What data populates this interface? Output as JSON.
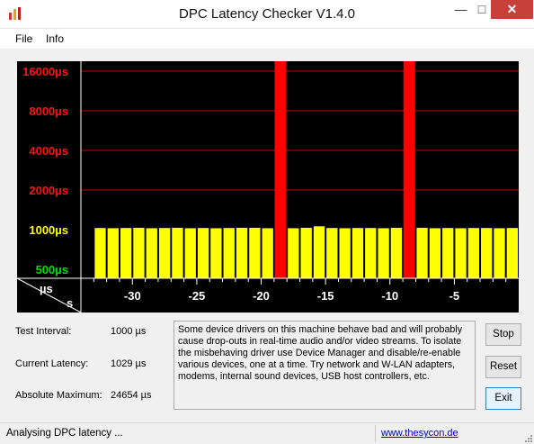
{
  "window": {
    "title": "DPC Latency Checker V1.4.0",
    "minimize_glyph": "—",
    "maximize_glyph": "□",
    "close_glyph": "✕",
    "icon": "app-bars-icon"
  },
  "menu": {
    "file": "File",
    "info": "Info"
  },
  "chart_data": {
    "type": "bar",
    "x_unit_label": "s",
    "y_unit_label": "µs",
    "x_ticks": [
      -30,
      -25,
      -20,
      -15,
      -10,
      -5
    ],
    "x_tick_labels": [
      "-30",
      "-25",
      "-20",
      "-15",
      "-10",
      "-5"
    ],
    "y_levels": [
      {
        "value": 500,
        "label": "500µs",
        "color": "#00e000"
      },
      {
        "value": 1000,
        "label": "1000µs",
        "color": "#ffff00"
      },
      {
        "value": 2000,
        "label": "2000µs",
        "color": "#ff1010"
      },
      {
        "value": 4000,
        "label": "4000µs",
        "color": "#ff1010"
      },
      {
        "value": 8000,
        "label": "8000µs",
        "color": "#ff1010"
      },
      {
        "value": 16000,
        "label": "16000µs",
        "color": "#ff1010"
      }
    ],
    "y_scale": "log",
    "bars": [
      {
        "t": -33,
        "value": 1029
      },
      {
        "t": -32,
        "value": 1025
      },
      {
        "t": -31,
        "value": 1029
      },
      {
        "t": -30,
        "value": 1033
      },
      {
        "t": -29,
        "value": 1025
      },
      {
        "t": -28,
        "value": 1029
      },
      {
        "t": -27,
        "value": 1033
      },
      {
        "t": -26,
        "value": 1025
      },
      {
        "t": -25,
        "value": 1029
      },
      {
        "t": -24,
        "value": 1025
      },
      {
        "t": -23,
        "value": 1029
      },
      {
        "t": -22,
        "value": 1033
      },
      {
        "t": -21,
        "value": 1033
      },
      {
        "t": -20,
        "value": 1025
      },
      {
        "t": -19,
        "value": 24654
      },
      {
        "t": -18,
        "value": 1025
      },
      {
        "t": -17,
        "value": 1033
      },
      {
        "t": -16,
        "value": 1060
      },
      {
        "t": -15,
        "value": 1029
      },
      {
        "t": -14,
        "value": 1025
      },
      {
        "t": -13,
        "value": 1029
      },
      {
        "t": -12,
        "value": 1029
      },
      {
        "t": -11,
        "value": 1025
      },
      {
        "t": -10,
        "value": 1033
      },
      {
        "t": -9,
        "value": 24654
      },
      {
        "t": -8,
        "value": 1033
      },
      {
        "t": -7,
        "value": 1025
      },
      {
        "t": -6,
        "value": 1029
      },
      {
        "t": -5,
        "value": 1025
      },
      {
        "t": -4,
        "value": 1029
      },
      {
        "t": -3,
        "value": 1029
      },
      {
        "t": -2,
        "value": 1025
      },
      {
        "t": -1,
        "value": 1029
      }
    ],
    "colors": {
      "normal": "#ffff00",
      "critical": "#ff0000",
      "background": "#000000",
      "gridline": "#c80000"
    }
  },
  "info": {
    "test_interval_label": "Test Interval:",
    "test_interval_value": "1000 µs",
    "current_latency_label": "Current Latency:",
    "current_latency_value": "1029 µs",
    "absolute_maximum_label": "Absolute Maximum:",
    "absolute_maximum_value": "24654 µs"
  },
  "description": "Some device drivers on this machine behave bad and will probably cause drop-outs in real-time audio and/or video streams. To isolate the misbehaving driver use Device Manager and disable/re-enable various devices, one at a time. Try network and W-LAN adapters, modems, internal sound devices, USB host controllers, etc.",
  "buttons": {
    "stop": "Stop",
    "reset": "Reset",
    "exit": "Exit"
  },
  "status": {
    "text": "Analysing DPC latency ...",
    "link": "www.thesycon.de"
  }
}
